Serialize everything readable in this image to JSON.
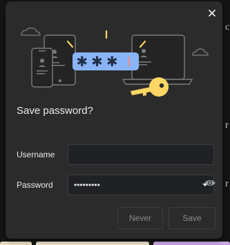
{
  "dialog": {
    "title": "Save password?",
    "close_icon": "close-icon",
    "username": {
      "label": "Username",
      "value": ""
    },
    "password": {
      "label": "Password",
      "value": "•••••••••",
      "dropdown_icon": "chevron-down-icon",
      "reveal_icon": "eye-icon"
    },
    "buttons": {
      "never": "Never",
      "save": "Save"
    }
  },
  "illustration": {
    "asterisks": "* * *",
    "icons": [
      "cloud-icon",
      "phone-icon",
      "tablet-icon",
      "laptop-icon",
      "key-icon",
      "password-field-icon"
    ]
  },
  "colors": {
    "dialog_bg": "#2b2b2b",
    "field_bg": "#202124",
    "text": "#e8eaed",
    "accent_blue": "#8ab4f8",
    "key_yellow": "#fdd663",
    "caret_red": "#f28b82",
    "button_disabled_text": "#8a8c8e"
  }
}
